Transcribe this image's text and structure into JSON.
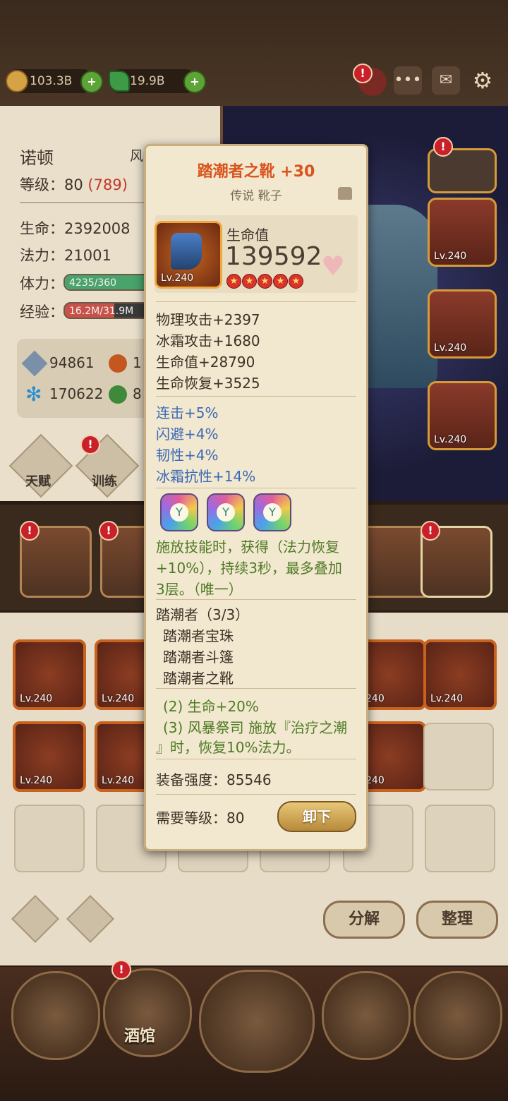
{
  "resources": {
    "gold": "103.3B",
    "gems": "19.9B"
  },
  "alerts": {
    "mark": "!"
  },
  "icons": {
    "plus": "+",
    "chat": "•••",
    "mail": "✉",
    "settings": "⚙"
  },
  "hero": {
    "name": "诺顿",
    "class_partial": "风暴祭司",
    "level_label": "等级：",
    "level": "80",
    "level_bonus": "(789)",
    "hp_label": "生命：",
    "hp": "2392008",
    "mp_label": "法力：",
    "mp": "21001",
    "stamina_label": "体力：",
    "stamina": "4235/360",
    "stamina_fraction": 1.0,
    "exp_label": "经验：",
    "exp": "16.2M/31.9M",
    "exp_fraction": 0.5,
    "stat1": "94861",
    "stat2": "1",
    "stat3": "170622",
    "stat4": "8",
    "talent": "天赋",
    "training": "训练"
  },
  "slot_level": "Lv.240",
  "tooltip": {
    "title": "踏潮者之靴 +30",
    "subtitle": "传说 靴子",
    "main_stat_label": "生命值",
    "main_stat_value": "139592",
    "item_level": "Lv.240",
    "stars": 5,
    "base_stats": [
      "物理攻击+2397",
      "冰霜攻击+1680",
      "生命值+28790",
      "生命恢复+3525"
    ],
    "extra_stats": [
      "连击+5%",
      "闪避+4%",
      "韧性+4%",
      "冰霜抗性+14%"
    ],
    "gem_symbol": "Y",
    "skill_text_lines": [
      "施放技能时，获得（法力恢复",
      "+10%），持续3秒，最多叠加",
      "3层。（唯一）"
    ],
    "set_title": "踏潮者（3/3）",
    "set_items": [
      "踏潮者宝珠",
      "踏潮者斗篷",
      "踏潮者之靴"
    ],
    "set_bonus_lines": [
      "(2) 生命+20%",
      "(3) 风暴祭司 施放『治疗之潮",
      "』时，恢复10%法力。"
    ],
    "power_label": "装备强度：",
    "power_value": "85546",
    "req_label": "需要等级：",
    "req_value": "80",
    "unequip": "卸下"
  },
  "inventory": {
    "decompose": "分解",
    "sort": "整理",
    "slot_level": "Lv.240",
    "partial_level": "240"
  },
  "nav": {
    "tavern": "酒馆"
  },
  "colors": {
    "title": "#d9541c",
    "green_text": "#4e7b25",
    "blue_text": "#3b69b5",
    "accent_gold": "#d79a39"
  }
}
